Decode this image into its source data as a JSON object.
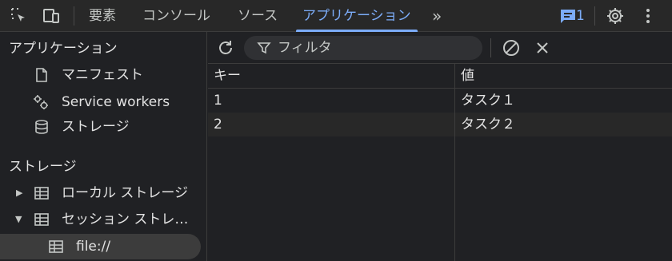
{
  "toolbar": {
    "tabs": [
      "要素",
      "コンソール",
      "ソース",
      "アプリケーション"
    ],
    "active_tab": "アプリケーション",
    "more_tabs_symbol": "»",
    "message_count": "1"
  },
  "sidebar": {
    "app_heading": "アプリケーション",
    "app_items": [
      {
        "label": "マニフェスト",
        "icon": "document-icon"
      },
      {
        "label": "Service workers",
        "icon": "gears-icon"
      },
      {
        "label": "ストレージ",
        "icon": "database-icon"
      }
    ],
    "storage_heading": "ストレージ",
    "storage_items": [
      {
        "label": "ローカル ストレージ",
        "icon": "table-icon",
        "expanded": false
      },
      {
        "label": "セッション ストレ…",
        "icon": "table-icon",
        "expanded": true
      }
    ],
    "session_child": {
      "label": "file://",
      "icon": "table-icon",
      "selected": true
    }
  },
  "panel": {
    "filter_placeholder": "フィルタ",
    "columns": [
      "キー",
      "値"
    ],
    "rows": [
      {
        "key": "1",
        "value": "タスク１"
      },
      {
        "key": "2",
        "value": "タスク２"
      }
    ]
  },
  "colors": {
    "background": "#202124",
    "accent": "#7cacf8",
    "text": "#e3e3e3",
    "selected_row": "#3c3c3c"
  }
}
